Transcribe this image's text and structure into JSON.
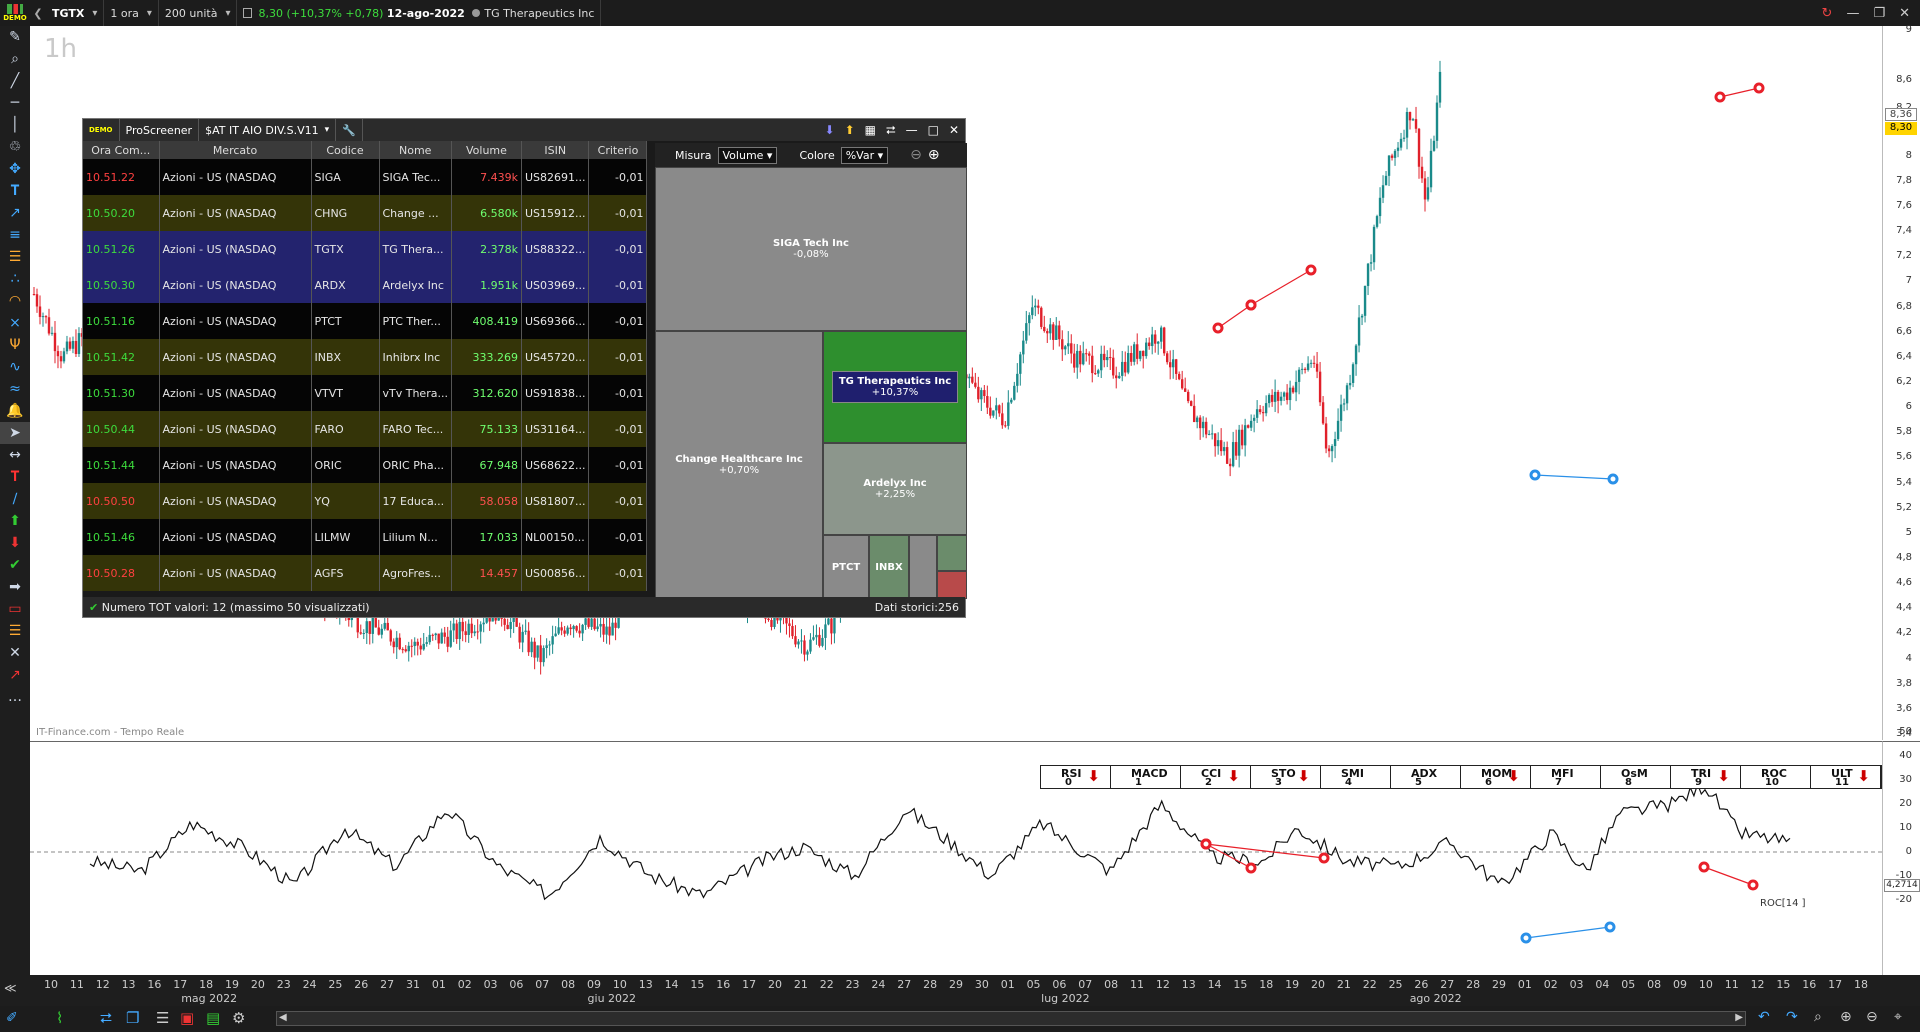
{
  "topbar": {
    "symbol": "TGTX",
    "timeframe": "1 ora",
    "units": "200 unità",
    "quote_price": "8,30",
    "quote_change": "(+10,37% +0,78)",
    "quote_date": "12-ago-2022",
    "company": "TG Therapeutics Inc",
    "logo_text": "DEMO"
  },
  "chart": {
    "timeframe_label": "1h",
    "source": "IT-Finance.com - Tempo Reale",
    "price_ticks": [
      "9",
      "8,6",
      "8,2",
      "8",
      "7,8",
      "7,6",
      "7,4",
      "7,2",
      "7",
      "6,8",
      "6,6",
      "6,4",
      "6,2",
      "6",
      "5,8",
      "5,6",
      "5,4",
      "5,2",
      "5",
      "4,8",
      "4,6",
      "4,4",
      "4,2",
      "4",
      "3,8",
      "3,6",
      "3,4"
    ],
    "last_price_badge": "8,36",
    "current_price_badge": "8,30",
    "osc_ticks": [
      "50",
      "40",
      "30",
      "20",
      "10",
      "0",
      "-10",
      "-20"
    ],
    "osc_value_badge": "4,2714",
    "osc_label": "ROC[14 ]"
  },
  "indicators": [
    {
      "name": "RSI",
      "num": "0",
      "arrow": true
    },
    {
      "name": "MACD",
      "num": "1",
      "arrow": false
    },
    {
      "name": "CCI",
      "num": "2",
      "arrow": true
    },
    {
      "name": "STO",
      "num": "3",
      "arrow": true
    },
    {
      "name": "SMI",
      "num": "4",
      "arrow": false
    },
    {
      "name": "ADX",
      "num": "5",
      "arrow": false
    },
    {
      "name": "MOM",
      "num": "6",
      "arrow": true
    },
    {
      "name": "MFI",
      "num": "7",
      "arrow": false
    },
    {
      "name": "OsM",
      "num": "8",
      "arrow": false
    },
    {
      "name": "TRI",
      "num": "9",
      "arrow": true
    },
    {
      "name": "ROC",
      "num": "10",
      "arrow": false
    },
    {
      "name": "ULT",
      "num": "11",
      "arrow": true
    }
  ],
  "xaxis": {
    "days": [
      "10",
      "11",
      "12",
      "13",
      "16",
      "17",
      "18",
      "19",
      "20",
      "23",
      "24",
      "25",
      "26",
      "27",
      "31",
      "01",
      "02",
      "03",
      "06",
      "07",
      "08",
      "09",
      "10",
      "13",
      "14",
      "15",
      "16",
      "17",
      "20",
      "21",
      "22",
      "23",
      "24",
      "27",
      "28",
      "29",
      "30",
      "01",
      "05",
      "06",
      "07",
      "08",
      "11",
      "12",
      "13",
      "14",
      "15",
      "18",
      "19",
      "20",
      "21",
      "22",
      "25",
      "26",
      "27",
      "28",
      "29",
      "01",
      "02",
      "03",
      "04",
      "05",
      "08",
      "09",
      "10",
      "11",
      "12",
      "15",
      "16",
      "17",
      "18"
    ],
    "months": [
      {
        "label": "mag 2022",
        "at": 0.08
      },
      {
        "label": "giu 2022",
        "at": 0.295
      },
      {
        "label": "lug 2022",
        "at": 0.535
      },
      {
        "label": "ago 2022",
        "at": 0.73
      }
    ]
  },
  "screener": {
    "app": "ProScreener",
    "list": "$AT IT AIO DIV.S.V11",
    "logo_text": "DEMO",
    "columns": [
      "Ora Com...",
      "Mercato",
      "Codice",
      "Nome",
      "Volume",
      "ISIN",
      "Criterio"
    ],
    "rows": [
      {
        "time": "10.51.22",
        "up": false,
        "market": "Azioni - US (NASDAQ",
        "code": "SIGA",
        "name": "SIGA Tec...",
        "volume": "7.439k",
        "vol_up": false,
        "isin": "US82691...",
        "crit": "-0,01"
      },
      {
        "time": "10.50.20",
        "up": true,
        "market": "Azioni - US (NASDAQ",
        "code": "CHNG",
        "name": "Change ...",
        "volume": "6.580k",
        "vol_up": true,
        "isin": "US15912...",
        "crit": "-0,01"
      },
      {
        "time": "10.51.26",
        "up": true,
        "market": "Azioni - US (NASDAQ",
        "code": "TGTX",
        "name": "TG Thera...",
        "volume": "2.378k",
        "vol_up": true,
        "isin": "US88322...",
        "crit": "-0,01"
      },
      {
        "time": "10.50.30",
        "up": true,
        "market": "Azioni - US (NASDAQ",
        "code": "ARDX",
        "name": "Ardelyx Inc",
        "volume": "1.951k",
        "vol_up": true,
        "isin": "US03969...",
        "crit": "-0,01"
      },
      {
        "time": "10.51.16",
        "up": true,
        "market": "Azioni - US (NASDAQ",
        "code": "PTCT",
        "name": "PTC Ther...",
        "volume": "408.419",
        "vol_up": true,
        "isin": "US69366...",
        "crit": "-0,01"
      },
      {
        "time": "10.51.42",
        "up": true,
        "market": "Azioni - US (NASDAQ",
        "code": "INBX",
        "name": "Inhibrx Inc",
        "volume": "333.269",
        "vol_up": true,
        "isin": "US45720...",
        "crit": "-0,01"
      },
      {
        "time": "10.51.30",
        "up": true,
        "market": "Azioni - US (NASDAQ",
        "code": "VTVT",
        "name": "vTv Thera...",
        "volume": "312.620",
        "vol_up": true,
        "isin": "US91838...",
        "crit": "-0,01"
      },
      {
        "time": "10.50.44",
        "up": true,
        "market": "Azioni - US (NASDAQ",
        "code": "FARO",
        "name": "FARO Tec...",
        "volume": "75.133",
        "vol_up": true,
        "isin": "US31164...",
        "crit": "-0,01"
      },
      {
        "time": "10.51.44",
        "up": true,
        "market": "Azioni - US (NASDAQ",
        "code": "ORIC",
        "name": "ORIC Pha...",
        "volume": "67.948",
        "vol_up": true,
        "isin": "US68622...",
        "crit": "-0,01"
      },
      {
        "time": "10.50.50",
        "up": false,
        "market": "Azioni - US (NASDAQ",
        "code": "YQ",
        "name": "17 Educa...",
        "volume": "58.058",
        "vol_up": false,
        "isin": "US81807...",
        "crit": "-0,01"
      },
      {
        "time": "10.51.46",
        "up": true,
        "market": "Azioni - US (NASDAQ",
        "code": "LILMW",
        "name": "Lilium N...",
        "volume": "17.033",
        "vol_up": true,
        "isin": "NL00150...",
        "crit": "-0,01"
      },
      {
        "time": "10.50.28",
        "up": false,
        "market": "Azioni - US (NASDAQ",
        "code": "AGFS",
        "name": "AgroFres...",
        "volume": "14.457",
        "vol_up": false,
        "isin": "US00856...",
        "crit": "-0,01"
      }
    ],
    "footer_left": "Numero TOT valori: 12 (massimo 50 visualizzati)",
    "footer_right": "Dati storici:256",
    "treemap": {
      "measure_label": "Misura",
      "measure_value": "Volume",
      "color_label": "Colore",
      "color_value": "%Var",
      "cells": [
        {
          "name": "SIGA Tech Inc",
          "pct": "-0,08%"
        },
        {
          "name": "Change Healthcare Inc",
          "pct": "+0,70%"
        },
        {
          "name": "TG Therapeutics Inc",
          "pct": "+10,37%"
        },
        {
          "name": "Ardelyx Inc",
          "pct": "+2,25%"
        },
        {
          "name": "PTCT",
          "pct": ""
        },
        {
          "name": "INBX",
          "pct": ""
        }
      ]
    }
  }
}
